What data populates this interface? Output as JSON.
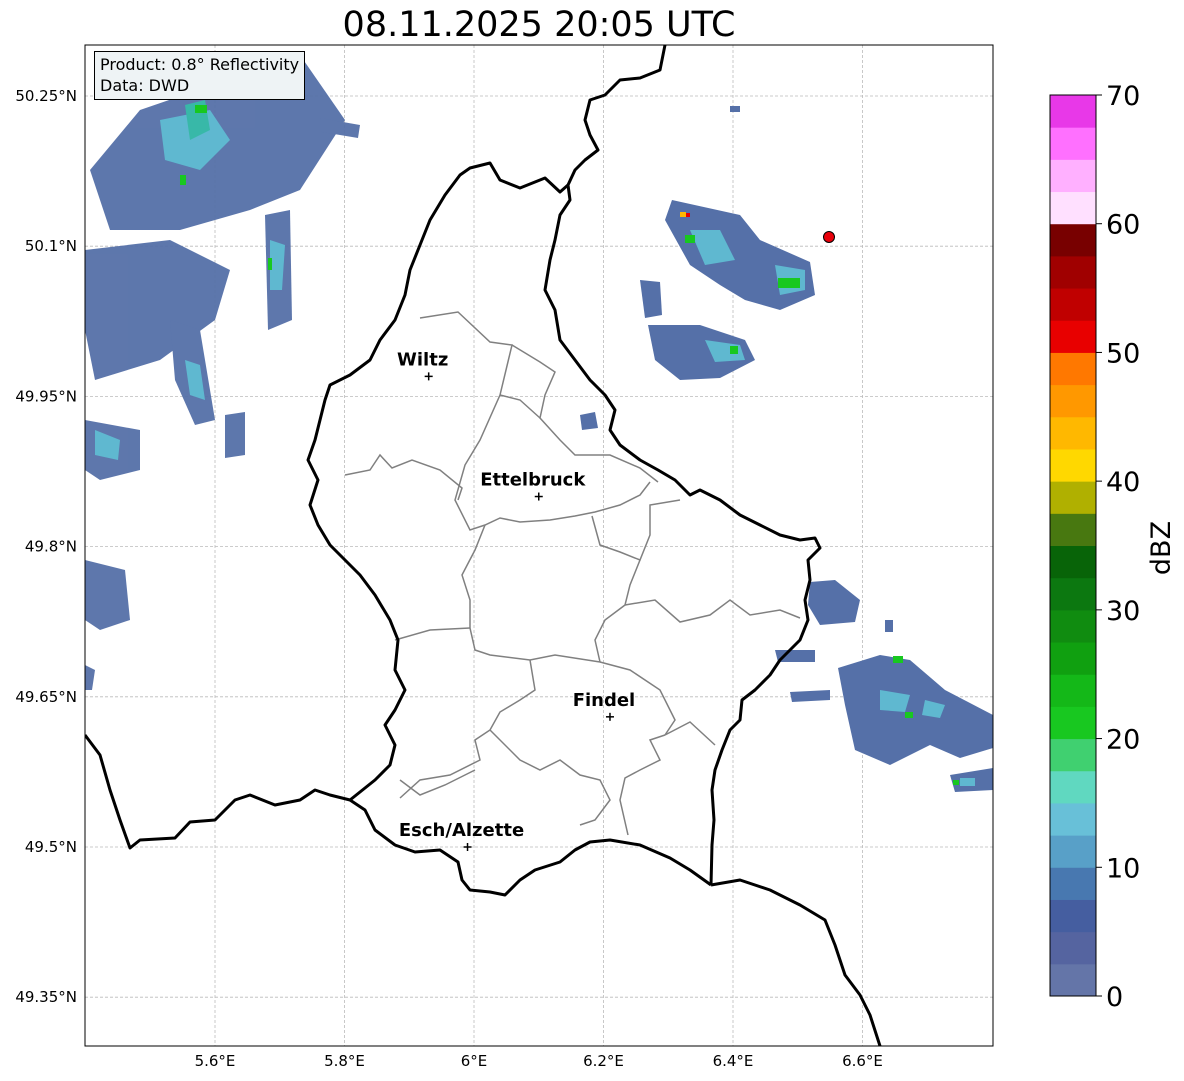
{
  "title": "08.11.2025 20:05 UTC",
  "info": {
    "product_line": "Product: 0.8° Reflectivity",
    "data_line": "Data: DWD"
  },
  "map": {
    "lon_ticks": [
      "5.6°E",
      "5.8°E",
      "6°E",
      "6.2°E",
      "6.4°E",
      "6.6°E"
    ],
    "lat_ticks": [
      "50.25°N",
      "50.1°N",
      "49.95°N",
      "49.8°N",
      "49.65°N",
      "49.5°N",
      "49.35°N"
    ],
    "cities": [
      {
        "name": "Wiltz",
        "lon": 5.93,
        "lat": 49.97
      },
      {
        "name": "Ettelbruck",
        "lon": 6.1,
        "lat": 49.85
      },
      {
        "name": "Findel",
        "lon": 6.21,
        "lat": 49.63
      },
      {
        "name": "Esch/Alzette",
        "lon": 5.99,
        "lat": 49.5
      }
    ],
    "radar_site_color": "#e8000b"
  },
  "colorbar": {
    "label": "dBZ",
    "ticks": [
      "0",
      "10",
      "20",
      "30",
      "40",
      "50",
      "60",
      "70"
    ],
    "range": [
      0,
      70
    ],
    "colors": [
      "#6475a8",
      "#5564a0",
      "#455ea0",
      "#4878b0",
      "#58a0c8",
      "#68c0d8",
      "#60d8c0",
      "#40d070",
      "#18c820",
      "#14b818",
      "#10a010",
      "#108c10",
      "#0c7810",
      "#086408",
      "#487810",
      "#b0b000",
      "#ffd800",
      "#ffb800",
      "#ff9800",
      "#ff7800",
      "#e80000",
      "#c00000",
      "#a00000",
      "#780000",
      "#ffe0ff",
      "#ffb0ff",
      "#ff70ff",
      "#e838e8"
    ]
  }
}
